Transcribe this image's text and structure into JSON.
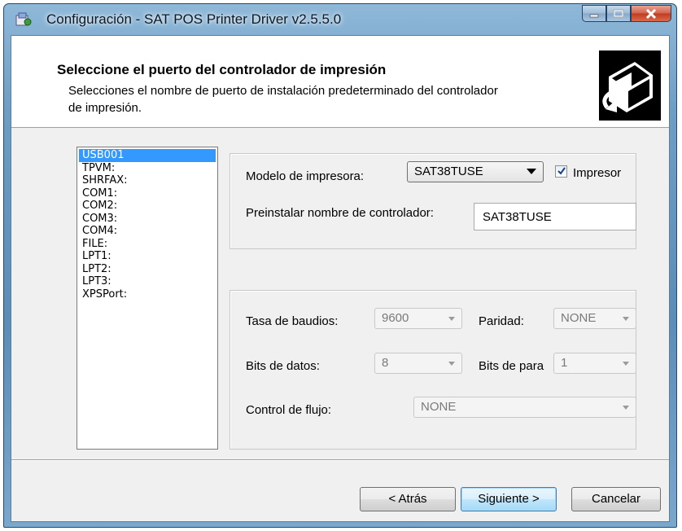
{
  "window": {
    "title": "Configuración - SAT POS Printer Driver v2.5.5.0"
  },
  "header": {
    "title": "Seleccione el puerto del controlador de impresión",
    "subtitle_line1": "Selecciones el nombre de puerto de instalación predeterminado del controlador",
    "subtitle_line2": "de impresión."
  },
  "ports": [
    "USB001",
    "TPVM:",
    "SHRFAX:",
    "COM1:",
    "COM2:",
    "COM3:",
    "COM4:",
    "FILE:",
    "LPT1:",
    "LPT2:",
    "LPT3:",
    "XPSPort:"
  ],
  "selected_port": "USB001",
  "printer": {
    "model_label": "Modelo de impresora:",
    "model_value": "SAT38TUSE",
    "checkbox_label": "Impresor",
    "checkbox_checked": true,
    "preinstall_label": "Preinstalar nombre de controlador:",
    "preinstall_value": "SAT38TUSE"
  },
  "serial": {
    "baud_label": "Tasa de baudios:",
    "baud_value": "9600",
    "parity_label": "Paridad:",
    "parity_value": "NONE",
    "databits_label": "Bits de datos:",
    "databits_value": "8",
    "stopbits_label": "Bits de para",
    "stopbits_value": "1",
    "flow_label": "Control de flujo:",
    "flow_value": "NONE"
  },
  "buttons": {
    "back": "< Atrás",
    "next": "Siguiente >",
    "cancel": "Cancelar"
  },
  "colors": {
    "selection": "#3399ff",
    "window_frame": "#6f9ec4",
    "close_button": "#c13a1f"
  },
  "icons": [
    "app-installer-icon",
    "minimize-icon",
    "maximize-icon",
    "close-icon",
    "printer-install-icon",
    "checkmark-icon",
    "dropdown-arrow-icon"
  ]
}
